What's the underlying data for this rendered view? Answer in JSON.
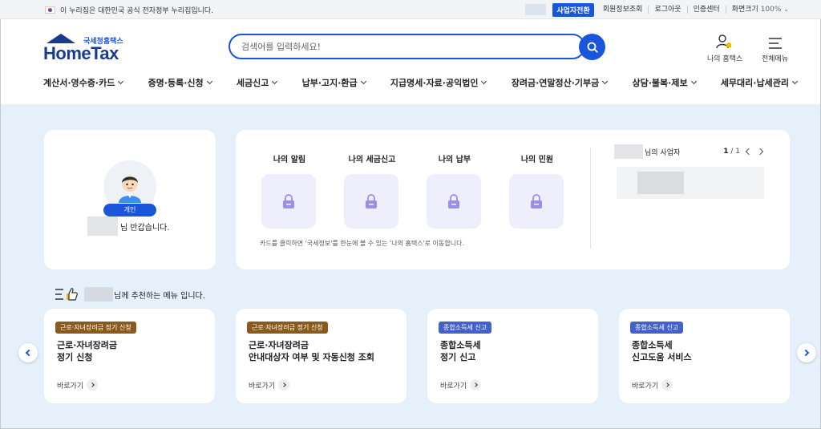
{
  "topbar": {
    "gov_notice": "이 누리집은 대한민국 공식 전자정부 누리집입니다.",
    "biz_switch": "사업자전환",
    "links": [
      "회원정보조회",
      "로그아웃",
      "인증센터"
    ],
    "zoom_label": "화면크기",
    "zoom_value": "100%"
  },
  "header": {
    "logo_sub": "국세청홈택스",
    "logo_main": "HomeTax",
    "search_placeholder": "검색어를 입력하세요!",
    "my_hometax": "나의 홈택스",
    "all_menu": "전체메뉴"
  },
  "nav": [
    "계산서·영수증·카드",
    "증명·등록·신청",
    "세금신고",
    "납부·고지·환급",
    "지급명세·자료·공익법인",
    "장려금·연말정산·기부금",
    "상담·불복·제보",
    "세무대리·납세관리"
  ],
  "profile": {
    "badge": "개인",
    "greeting": "님 반갑습니다."
  },
  "my": {
    "tiles": [
      "나의 알림",
      "나의 세금신고",
      "나의 납부",
      "나의 민원"
    ],
    "note": "카드를 클릭하면 '국세정보'를 한눈에 볼 수 있는 '나의 홈택스'로 이동합니다.",
    "biz_label": "님의 사업자",
    "page_current": "1",
    "page_total": "/ 1"
  },
  "recommend": {
    "title": "님께 추천하는 메뉴 입니다.",
    "go_label": "바로가기",
    "cards": [
      {
        "tag": "근로·자녀장려금 정기 신청",
        "line1": "근로·자녀장려금",
        "line2": "정기 신청"
      },
      {
        "tag": "근로·자녀장려금 정기 신청",
        "line1": "근로·자녀장려금",
        "line2": "안내대상자 여부 및 자동신청 조회"
      },
      {
        "tag": "종합소득세 신고",
        "line1": "종합소득세",
        "line2": "정기 신고"
      },
      {
        "tag": "종합소득세 신고",
        "line1": "종합소득세",
        "line2": "신고도움 서비스"
      }
    ]
  },
  "colors": {
    "primary": "#1a56db",
    "navy": "#1a3a8f",
    "content_bg": "#e6f0fb",
    "tag_brown": "#8a5a1c",
    "tag_blue": "#4361c9"
  }
}
